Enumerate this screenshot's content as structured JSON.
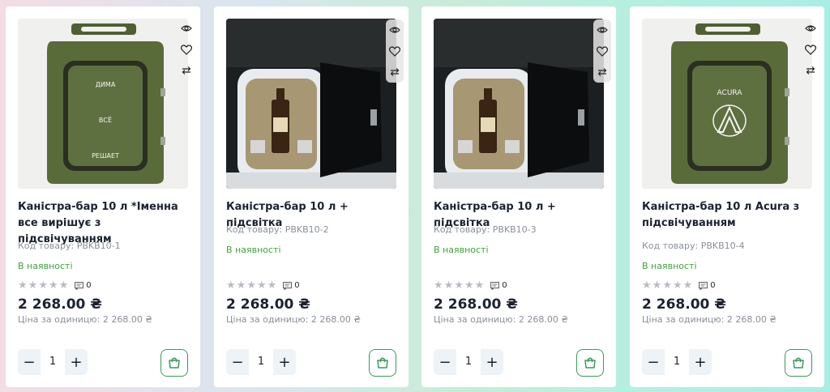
{
  "labels": {
    "sku_prefix": "Код товару: ",
    "unit_prefix": "Ціна за одиницю: ",
    "stock": "В наявності"
  },
  "products": [
    {
      "title": "Каністра-бар 10 л *Іменна все вирішує з підсвічуванням",
      "sku": "Код товару: PBKB10-1",
      "stock": "В наявності",
      "rating": 0,
      "comments": "0",
      "price": "2 268.00 ₴",
      "unit_price": "Ціна за одиницю: 2 268.00 ₴",
      "qty": "1",
      "image_lines": [
        "ДИМА",
        "ВСЁ",
        "РЕШАЕТ"
      ]
    },
    {
      "title": "Каністра-бар 10 л + підсвітка",
      "sku": "Код товару: PBKB10-2",
      "stock": "В наявності",
      "rating": 0,
      "comments": "0",
      "price": "2 268.00 ₴",
      "unit_price": "Ціна за одиницю: 2 268.00 ₴",
      "qty": "1"
    },
    {
      "title": "Каністра-бар 10 л + підсвітка",
      "sku": "Код товару: PBKB10-3",
      "stock": "В наявності",
      "rating": 0,
      "comments": "0",
      "price": "2 268.00 ₴",
      "unit_price": "Ціна за одиницю: 2 268.00 ₴",
      "qty": "1"
    },
    {
      "title": "Каністра-бар 10 л Acura з підсвічуванням",
      "sku": "Код товару: PBKB10-4",
      "stock": "В наявності",
      "rating": 0,
      "comments": "0",
      "price": "2 268.00 ₴",
      "unit_price": "Ціна за одиницю: 2 268.00 ₴",
      "qty": "1",
      "image_lines": [
        "ACURA"
      ]
    }
  ],
  "colors": {
    "accent_green": "#3a9a5c",
    "stock_green": "#3da33a",
    "canister": "#5a6b3a"
  },
  "icons": [
    "eye-icon",
    "heart-icon",
    "compare-icon",
    "star-icon",
    "comment-icon",
    "minus-icon",
    "plus-icon",
    "cart-icon"
  ]
}
